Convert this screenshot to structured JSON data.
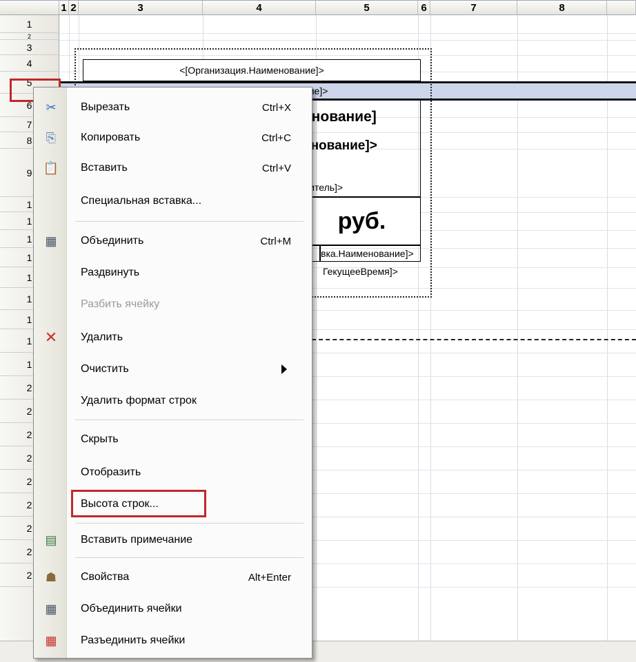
{
  "columns": [
    "1",
    "2",
    "3",
    "4",
    "5",
    "6",
    "7",
    "8"
  ],
  "rows": [
    "1",
    "2",
    "3",
    "4",
    "5",
    "6",
    "7",
    "8",
    "9",
    "1",
    "1",
    "1",
    "1",
    "1",
    "1",
    "1",
    "1",
    "1",
    "2",
    "2",
    "2",
    "2",
    "2",
    "2",
    "2",
    "2",
    "2"
  ],
  "cells": {
    "org_name": "<[Организация.Наименование]>",
    "row4_partial": "ние]>",
    "bold_name": "енование]",
    "bold_name2": "енование]>",
    "manager": "дитель]>",
    "currency": "руб.",
    "price_type": "вка.Наименование]>",
    "price_type_left": "и",
    "current_time": "ГекущееВремя]>"
  },
  "context_menu": {
    "items": [
      {
        "label": "Вырезать",
        "shortcut": "Ctrl+X",
        "icon": "scissors-icon",
        "glyph": "✂"
      },
      {
        "label": "Копировать",
        "shortcut": "Ctrl+C",
        "icon": "copy-icon",
        "glyph": "⎘"
      },
      {
        "label": "Вставить",
        "shortcut": "Ctrl+V",
        "icon": "paste-icon",
        "glyph": "📋"
      },
      {
        "label": "Специальная вставка...",
        "shortcut": "",
        "icon": "",
        "glyph": ""
      },
      {
        "label": "Объединить",
        "shortcut": "Ctrl+M",
        "icon": "merge-icon",
        "glyph": "▦"
      },
      {
        "label": "Раздвинуть",
        "shortcut": "",
        "icon": "",
        "glyph": ""
      },
      {
        "label": "Разбить ячейку",
        "shortcut": "",
        "icon": "",
        "glyph": "",
        "disabled": true
      },
      {
        "label": "Удалить",
        "shortcut": "",
        "icon": "delete-icon",
        "glyph": "✕"
      },
      {
        "label": "Очистить",
        "shortcut": "",
        "icon": "",
        "glyph": "",
        "submenu": true
      },
      {
        "label": "Удалить формат строк",
        "shortcut": "",
        "icon": "",
        "glyph": ""
      },
      {
        "label": "Скрыть",
        "shortcut": "",
        "icon": "",
        "glyph": ""
      },
      {
        "label": "Отобразить",
        "shortcut": "",
        "icon": "",
        "glyph": ""
      },
      {
        "label": "Высота строк...",
        "shortcut": "",
        "icon": "",
        "glyph": "",
        "highlighted": true
      },
      {
        "label": "Вставить примечание",
        "shortcut": "",
        "icon": "note-icon",
        "glyph": "▤"
      },
      {
        "label": "Свойства",
        "shortcut": "Alt+Enter",
        "icon": "properties-icon",
        "glyph": "☗"
      },
      {
        "label": "Объединить ячейки",
        "shortcut": "",
        "icon": "merge-cells-icon",
        "glyph": "▦"
      },
      {
        "label": "Разъединить ячейки",
        "shortcut": "",
        "icon": "unmerge-cells-icon",
        "glyph": "▦"
      }
    ]
  },
  "colors": {
    "highlight_red": "#c0272d",
    "selected_row": "#cdd5ea",
    "delete_red": "#c8312b"
  }
}
